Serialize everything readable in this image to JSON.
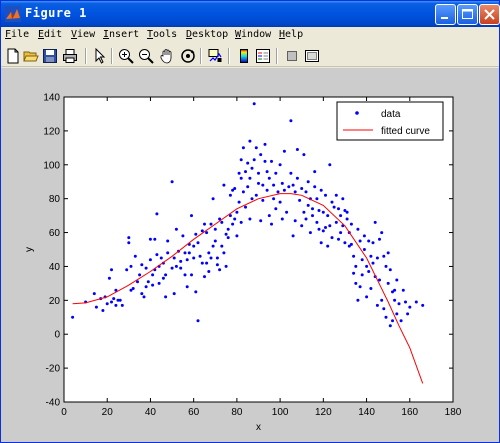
{
  "window": {
    "title": "Figure 1"
  },
  "menu": [
    {
      "ul": "F",
      "rest": "ile"
    },
    {
      "ul": "E",
      "rest": "dit"
    },
    {
      "ul": "V",
      "rest": "iew"
    },
    {
      "ul": "I",
      "rest": "nsert"
    },
    {
      "ul": "T",
      "rest": "ools"
    },
    {
      "ul": "D",
      "rest": "esktop"
    },
    {
      "ul": "W",
      "rest": "indow"
    },
    {
      "ul": "H",
      "rest": "elp"
    }
  ],
  "toolbar": [
    "new-figure-icon",
    "open-file-icon",
    "save-icon",
    "print-icon",
    "edit-plot-arrow-icon",
    "zoom-in-icon",
    "zoom-out-icon",
    "pan-hand-icon",
    "rotate-3d-icon",
    "data-cursor-icon",
    "colorbar-icon",
    "legend-icon",
    "hide-plot-tools-icon",
    "show-plot-tools-icon"
  ],
  "chart_data": {
    "type": "scatter",
    "xlabel": "x",
    "ylabel": "y",
    "xlim": [
      0,
      180
    ],
    "ylim": [
      -40,
      140
    ],
    "xticks": [
      0,
      20,
      40,
      60,
      80,
      100,
      120,
      140,
      160,
      180
    ],
    "yticks": [
      -40,
      -20,
      0,
      20,
      40,
      60,
      80,
      100,
      120,
      140
    ],
    "grid": false,
    "legend_position": "top-right",
    "series": [
      {
        "name": "data",
        "kind": "points",
        "color": "#0000ff",
        "points": [
          [
            4,
            10
          ],
          [
            10,
            19
          ],
          [
            14,
            24
          ],
          [
            15,
            16
          ],
          [
            17,
            21
          ],
          [
            18,
            14
          ],
          [
            19,
            22
          ],
          [
            20,
            18
          ],
          [
            21,
            33
          ],
          [
            22,
            38
          ],
          [
            22,
            19
          ],
          [
            23,
            21
          ],
          [
            24,
            17
          ],
          [
            24,
            26
          ],
          [
            25,
            20
          ],
          [
            26,
            20
          ],
          [
            27,
            17
          ],
          [
            29,
            38
          ],
          [
            30,
            57
          ],
          [
            30,
            54
          ],
          [
            31,
            26
          ],
          [
            31,
            40
          ],
          [
            32,
            27
          ],
          [
            33,
            46
          ],
          [
            34,
            31
          ],
          [
            35,
            35
          ],
          [
            36,
            41
          ],
          [
            36,
            24
          ],
          [
            37,
            22
          ],
          [
            38,
            28
          ],
          [
            38,
            39
          ],
          [
            39,
            31
          ],
          [
            40,
            56
          ],
          [
            40,
            44
          ],
          [
            41,
            29
          ],
          [
            41,
            35
          ],
          [
            42,
            56
          ],
          [
            42,
            38
          ],
          [
            43,
            71
          ],
          [
            43,
            47
          ],
          [
            44,
            30
          ],
          [
            44,
            40
          ],
          [
            45,
            45
          ],
          [
            46,
            33
          ],
          [
            46,
            42
          ],
          [
            47,
            35
          ],
          [
            47,
            22
          ],
          [
            48,
            55
          ],
          [
            48,
            48
          ],
          [
            50,
            39
          ],
          [
            50,
            90
          ],
          [
            51,
            45
          ],
          [
            51,
            24
          ],
          [
            52,
            40
          ],
          [
            52,
            62
          ],
          [
            53,
            49
          ],
          [
            54,
            43
          ],
          [
            54,
            39
          ],
          [
            55,
            58
          ],
          [
            56,
            48
          ],
          [
            56,
            35
          ],
          [
            57,
            28
          ],
          [
            57,
            44
          ],
          [
            58,
            53
          ],
          [
            58,
            48
          ],
          [
            59,
            70
          ],
          [
            59,
            35
          ],
          [
            60,
            45
          ],
          [
            60,
            52
          ],
          [
            61,
            59
          ],
          [
            61,
            25
          ],
          [
            62,
            54
          ],
          [
            62,
            8
          ],
          [
            63,
            46
          ],
          [
            64,
            42
          ],
          [
            64,
            61
          ],
          [
            65,
            34
          ],
          [
            65,
            65
          ],
          [
            66,
            60
          ],
          [
            66,
            42
          ],
          [
            67,
            48
          ],
          [
            67,
            37
          ],
          [
            68,
            65
          ],
          [
            68,
            45
          ],
          [
            69,
            52
          ],
          [
            69,
            80
          ],
          [
            70,
            62
          ],
          [
            70,
            55
          ],
          [
            71,
            45
          ],
          [
            71,
            41
          ],
          [
            72,
            38
          ],
          [
            72,
            68
          ],
          [
            73,
            66
          ],
          [
            73,
            52
          ],
          [
            74,
            48
          ],
          [
            74,
            88
          ],
          [
            75,
            59
          ],
          [
            75,
            40
          ],
          [
            76,
            62
          ],
          [
            76,
            57
          ],
          [
            77,
            70
          ],
          [
            77,
            82
          ],
          [
            78,
            65
          ],
          [
            78,
            85
          ],
          [
            79,
            68
          ],
          [
            79,
            86
          ],
          [
            80,
            72
          ],
          [
            80,
            58
          ],
          [
            81,
            95
          ],
          [
            81,
            78
          ],
          [
            82,
            66
          ],
          [
            82,
            92
          ],
          [
            82,
            103
          ],
          [
            83,
            110
          ],
          [
            83,
            84
          ],
          [
            84,
            96
          ],
          [
            84,
            75
          ],
          [
            85,
            87
          ],
          [
            85,
            101
          ],
          [
            86,
            68
          ],
          [
            86,
            114
          ],
          [
            86,
            92
          ],
          [
            87,
            80
          ],
          [
            87,
            98
          ],
          [
            88,
            136
          ],
          [
            88,
            103
          ],
          [
            89,
            82
          ],
          [
            89,
            110
          ],
          [
            90,
            89
          ],
          [
            90,
            95
          ],
          [
            91,
            67
          ],
          [
            91,
            106
          ],
          [
            92,
            79
          ],
          [
            92,
            88
          ],
          [
            93,
            102
          ],
          [
            93,
            112
          ],
          [
            94,
            85
          ],
          [
            94,
            96
          ],
          [
            95,
            70
          ],
          [
            95,
            92
          ],
          [
            96,
            65
          ],
          [
            96,
            102
          ],
          [
            97,
            80
          ],
          [
            97,
            88
          ],
          [
            98,
            74
          ],
          [
            98,
            95
          ],
          [
            99,
            84
          ],
          [
            100,
            100
          ],
          [
            100,
            78
          ],
          [
            101,
            68
          ],
          [
            101,
            89
          ],
          [
            102,
            85
          ],
          [
            102,
            108
          ],
          [
            103,
            72
          ],
          [
            104,
            87
          ],
          [
            105,
            126
          ],
          [
            105,
            95
          ],
          [
            106,
            58
          ],
          [
            106,
            88
          ],
          [
            107,
            84
          ],
          [
            107,
            67
          ],
          [
            108,
            92
          ],
          [
            108,
            109
          ],
          [
            109,
            79
          ],
          [
            110,
            64
          ],
          [
            110,
            86
          ],
          [
            111,
            72
          ],
          [
            111,
            106
          ],
          [
            112,
            68
          ],
          [
            112,
            84
          ],
          [
            113,
            90
          ],
          [
            113,
            76
          ],
          [
            114,
            60
          ],
          [
            114,
            80
          ],
          [
            115,
            74
          ],
          [
            115,
            70
          ],
          [
            116,
            96
          ],
          [
            116,
            87
          ],
          [
            117,
            66
          ],
          [
            117,
            80
          ],
          [
            118,
            73
          ],
          [
            118,
            62
          ],
          [
            119,
            85
          ],
          [
            119,
            54
          ],
          [
            120,
            72
          ],
          [
            120,
            61
          ],
          [
            121,
            63
          ],
          [
            121,
            82
          ],
          [
            122,
            52
          ],
          [
            122,
            70
          ],
          [
            123,
            100
          ],
          [
            123,
            64
          ],
          [
            124,
            57
          ],
          [
            124,
            78
          ],
          [
            125,
            75
          ],
          [
            126,
            66
          ],
          [
            126,
            82
          ],
          [
            127,
            74
          ],
          [
            127,
            56
          ],
          [
            128,
            70
          ],
          [
            128,
            60
          ],
          [
            129,
            80
          ],
          [
            129,
            64
          ],
          [
            130,
            73
          ],
          [
            130,
            54
          ],
          [
            131,
            68
          ],
          [
            131,
            72
          ],
          [
            132,
            60
          ],
          [
            132,
            52
          ],
          [
            133,
            53
          ],
          [
            133,
            65
          ],
          [
            134,
            36
          ],
          [
            134,
            46
          ],
          [
            135,
            30
          ],
          [
            135,
            40
          ],
          [
            136,
            20
          ],
          [
            136,
            62
          ],
          [
            137,
            55
          ],
          [
            137,
            28
          ],
          [
            138,
            44
          ],
          [
            138,
            35
          ],
          [
            139,
            50
          ],
          [
            139,
            58
          ],
          [
            140,
            40
          ],
          [
            140,
            22
          ],
          [
            141,
            37
          ],
          [
            141,
            55
          ],
          [
            142,
            46
          ],
          [
            142,
            27
          ],
          [
            143,
            42
          ],
          [
            143,
            54
          ],
          [
            144,
            34
          ],
          [
            144,
            66
          ],
          [
            145,
            45
          ],
          [
            145,
            17
          ],
          [
            146,
            32
          ],
          [
            146,
            56
          ],
          [
            147,
            20
          ],
          [
            147,
            60
          ],
          [
            148,
            15
          ],
          [
            148,
            46
          ],
          [
            149,
            40
          ],
          [
            149,
            10
          ],
          [
            150,
            30
          ],
          [
            150,
            48
          ],
          [
            151,
            5
          ],
          [
            151,
            38
          ],
          [
            152,
            8
          ],
          [
            152,
            25
          ],
          [
            153,
            20
          ],
          [
            153,
            26
          ],
          [
            154,
            12
          ],
          [
            154,
            32
          ],
          [
            155,
            18
          ],
          [
            156,
            8
          ],
          [
            157,
            26
          ],
          [
            158,
            19
          ],
          [
            159,
            12
          ],
          [
            160,
            16
          ],
          [
            163,
            19
          ],
          [
            166,
            17
          ]
        ]
      },
      {
        "name": "fitted curve",
        "kind": "line",
        "color": "#ff0000",
        "x": [
          4,
          10,
          20,
          30,
          40,
          50,
          60,
          70,
          80,
          90,
          100,
          105,
          110,
          120,
          130,
          140,
          150,
          155,
          160,
          166
        ],
        "values": [
          18,
          18.5,
          22,
          29,
          37,
          46,
          56,
          65,
          74,
          80,
          83,
          83,
          82,
          76,
          64,
          45,
          19,
          5,
          -8,
          -29
        ]
      }
    ]
  }
}
